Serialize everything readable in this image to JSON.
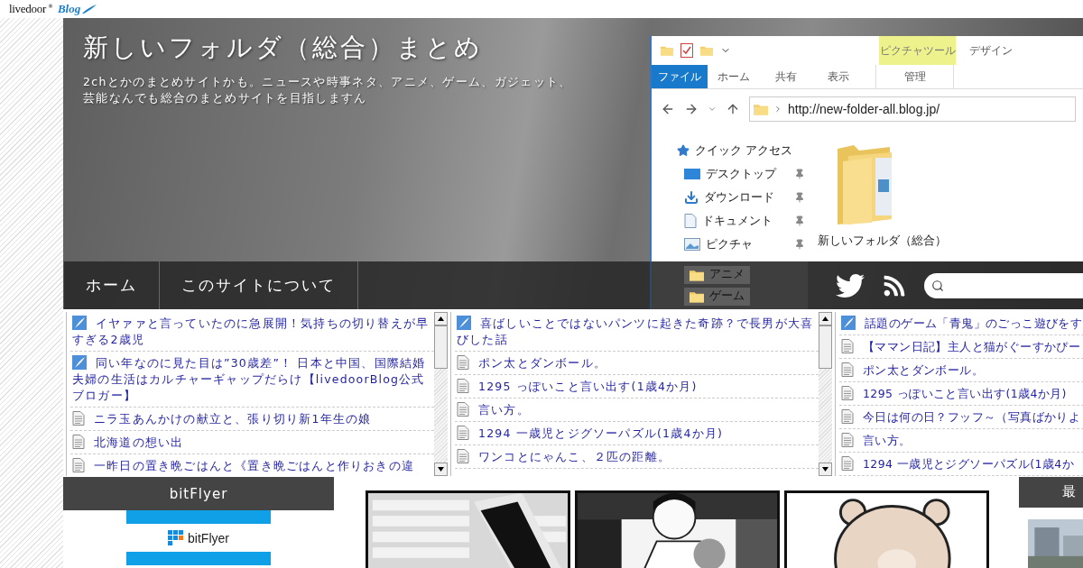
{
  "topbar": {
    "logo": "livedoor",
    "logo_mark": "®",
    "logo_sub": "Blog"
  },
  "header": {
    "title": "新しいフォルダ（総合）まとめ",
    "description_lines": [
      "2chとかのまとめサイトかも。ニュースや時事ネタ、アニメ、ゲーム、ガジェット、",
      "芸能なんでも総合のまとめサイトを目指しますん"
    ]
  },
  "explorer": {
    "context_group": "ピクチャツール",
    "extra_tab": "デザイン",
    "tabs": [
      {
        "label": "ファイル",
        "kind": "file"
      },
      {
        "label": "ホーム",
        "kind": "tab"
      },
      {
        "label": "共有",
        "kind": "tab"
      },
      {
        "label": "表示",
        "kind": "tab"
      },
      {
        "label": "管理",
        "kind": "context"
      }
    ],
    "address": "http://new-folder-all.blog.jp/",
    "nav_items": [
      {
        "label": "クイック アクセス",
        "kind": "star",
        "pinned": false
      },
      {
        "label": "デスクトップ",
        "kind": "desktop",
        "pinned": true
      },
      {
        "label": "ダウンロード",
        "kind": "download",
        "pinned": true
      },
      {
        "label": "ドキュメント",
        "kind": "document",
        "pinned": true
      },
      {
        "label": "ピクチャ",
        "kind": "picture",
        "pinned": true
      },
      {
        "label": "アニメ",
        "kind": "folder",
        "pinned": false
      },
      {
        "label": "ゲーム",
        "kind": "folder",
        "pinned": false
      }
    ],
    "folder_label": "新しいフォルダ（総合）"
  },
  "nav": {
    "items": [
      "ホーム",
      "このサイトについて"
    ]
  },
  "feeds": [
    {
      "items": [
        {
          "kind": "blog",
          "text": "イヤァァと言っていたのに急展開！気持ちの切り替えが早すぎる2歳児"
        },
        {
          "kind": "blog",
          "text": "同い年なのに見た目は”30歳差”！ 日本と中国、国際結婚夫婦の生活はカルチャーギャップだらけ【livedoorBlog公式ブロガー】"
        },
        {
          "kind": "page",
          "text": "ニラ玉あんかけの献立と、張り切り新1年生の娘"
        },
        {
          "kind": "page",
          "text": "北海道の想い出"
        },
        {
          "kind": "page",
          "text": "一昨日の置き晩ごはんと《置き晩ごはんと作りおきの違"
        }
      ]
    },
    {
      "items": [
        {
          "kind": "blog",
          "text": "喜ばしいことではないパンツに起きた奇跡？で長男が大喜びした話"
        },
        {
          "kind": "page",
          "text": "ポン太とダンボール。"
        },
        {
          "kind": "page",
          "text": "1295 っぽいこと言い出す(1歳4か月)"
        },
        {
          "kind": "page",
          "text": "言い方。"
        },
        {
          "kind": "page",
          "text": "1294 一歳児とジグソーパズル(1歳4か月)"
        },
        {
          "kind": "page",
          "text": "ワンコとにゃんこ、２匹の距離。"
        }
      ]
    },
    {
      "items": [
        {
          "kind": "blog",
          "text": "話題のゲーム「青鬼」のごっこ遊びをす"
        },
        {
          "kind": "page",
          "text": "【ママン日記】主人と猫がぐーすかぴー"
        },
        {
          "kind": "page",
          "text": "ポン太とダンボール。"
        },
        {
          "kind": "page",
          "text": "1295 っぽいこと言い出す(1歳4か月)"
        },
        {
          "kind": "page",
          "text": "今日は何の日？フッフ～（写真ばかりよ"
        },
        {
          "kind": "page",
          "text": "言い方。"
        },
        {
          "kind": "page",
          "text": "1294 一歳児とジグソーパズル(1歳4か"
        }
      ]
    }
  ],
  "sidebar": {
    "heading": "bitFlyer",
    "banner": "bitFlyer"
  },
  "right_heading": "最"
}
